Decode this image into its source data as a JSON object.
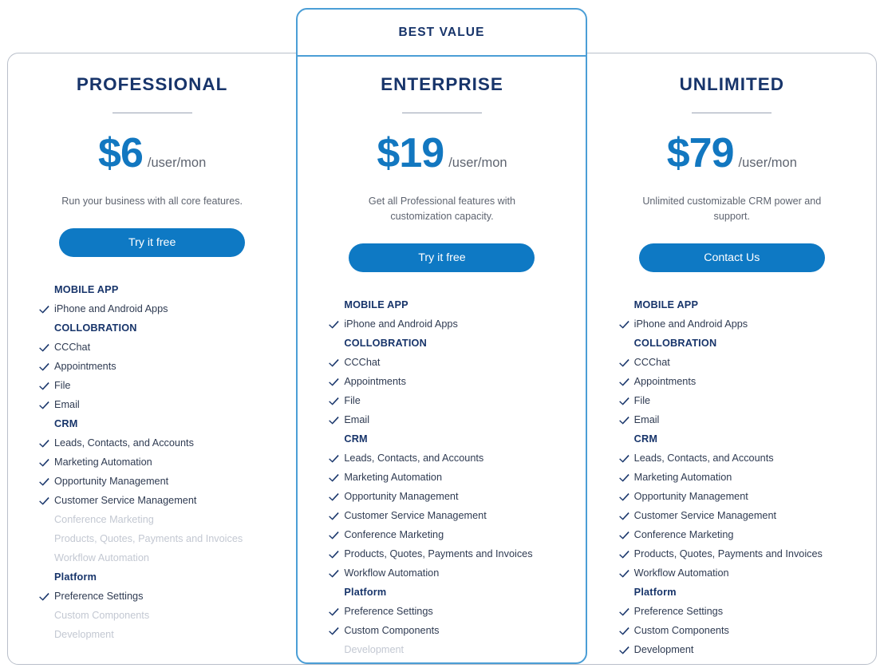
{
  "featured_badge": "BEST VALUE",
  "colors": {
    "heading_navy": "#17346a",
    "price_blue": "#1277c0",
    "button_blue": "#0e79c4",
    "featured_border": "#4b9ed6",
    "card_border": "#b9bfca",
    "muted_text": "#5e6470",
    "disabled_text": "#c3c8d2"
  },
  "plans": [
    {
      "name": "PROFESSIONAL",
      "price": "$6",
      "period": "/user/mon",
      "description": "Run your business with all core features.",
      "cta_label": "Try it free",
      "featured": false,
      "sections": [
        {
          "title": "MOBILE APP",
          "items": [
            {
              "label": "iPhone and Android Apps",
              "included": true
            }
          ]
        },
        {
          "title": "COLLOBRATION",
          "items": [
            {
              "label": "CCChat",
              "included": true
            },
            {
              "label": "Appointments",
              "included": true
            },
            {
              "label": "File",
              "included": true
            },
            {
              "label": "Email",
              "included": true
            }
          ]
        },
        {
          "title": "CRM",
          "items": [
            {
              "label": "Leads, Contacts, and Accounts",
              "included": true
            },
            {
              "label": "Marketing Automation",
              "included": true
            },
            {
              "label": "Opportunity Management",
              "included": true
            },
            {
              "label": "Customer Service Management",
              "included": true
            },
            {
              "label": "Conference Marketing",
              "included": false
            },
            {
              "label": "Products, Quotes, Payments and Invoices",
              "included": false
            },
            {
              "label": "Workflow Automation",
              "included": false
            }
          ]
        },
        {
          "title": "Platform",
          "items": [
            {
              "label": "Preference Settings",
              "included": true
            },
            {
              "label": "Custom Components",
              "included": false
            },
            {
              "label": "Development",
              "included": false
            }
          ]
        }
      ]
    },
    {
      "name": "ENTERPRISE",
      "price": "$19",
      "period": "/user/mon",
      "description": "Get all Professional features with customization capacity.",
      "cta_label": "Try it free",
      "featured": true,
      "sections": [
        {
          "title": "MOBILE APP",
          "items": [
            {
              "label": "iPhone and Android Apps",
              "included": true
            }
          ]
        },
        {
          "title": "COLLOBRATION",
          "items": [
            {
              "label": "CCChat",
              "included": true
            },
            {
              "label": "Appointments",
              "included": true
            },
            {
              "label": "File",
              "included": true
            },
            {
              "label": "Email",
              "included": true
            }
          ]
        },
        {
          "title": "CRM",
          "items": [
            {
              "label": "Leads, Contacts, and Accounts",
              "included": true
            },
            {
              "label": "Marketing Automation",
              "included": true
            },
            {
              "label": "Opportunity Management",
              "included": true
            },
            {
              "label": "Customer Service Management",
              "included": true
            },
            {
              "label": "Conference Marketing",
              "included": true
            },
            {
              "label": "Products, Quotes, Payments and Invoices",
              "included": true
            },
            {
              "label": "Workflow Automation",
              "included": true
            }
          ]
        },
        {
          "title": "Platform",
          "items": [
            {
              "label": "Preference Settings",
              "included": true
            },
            {
              "label": "Custom Components",
              "included": true
            },
            {
              "label": "Development",
              "included": false
            }
          ]
        }
      ]
    },
    {
      "name": "UNLIMITED",
      "price": "$79",
      "period": "/user/mon",
      "description": "Unlimited customizable CRM power and support.",
      "cta_label": "Contact Us",
      "featured": false,
      "sections": [
        {
          "title": "MOBILE APP",
          "items": [
            {
              "label": "iPhone and Android Apps",
              "included": true
            }
          ]
        },
        {
          "title": "COLLOBRATION",
          "items": [
            {
              "label": "CCChat",
              "included": true
            },
            {
              "label": "Appointments",
              "included": true
            },
            {
              "label": "File",
              "included": true
            },
            {
              "label": "Email",
              "included": true
            }
          ]
        },
        {
          "title": "CRM",
          "items": [
            {
              "label": "Leads, Contacts, and Accounts",
              "included": true
            },
            {
              "label": "Marketing Automation",
              "included": true
            },
            {
              "label": "Opportunity Management",
              "included": true
            },
            {
              "label": "Customer Service Management",
              "included": true
            },
            {
              "label": "Conference Marketing",
              "included": true
            },
            {
              "label": "Products, Quotes, Payments and Invoices",
              "included": true
            },
            {
              "label": "Workflow Automation",
              "included": true
            }
          ]
        },
        {
          "title": "Platform",
          "items": [
            {
              "label": "Preference Settings",
              "included": true
            },
            {
              "label": "Custom Components",
              "included": true
            },
            {
              "label": "Development",
              "included": true
            }
          ]
        }
      ]
    }
  ]
}
